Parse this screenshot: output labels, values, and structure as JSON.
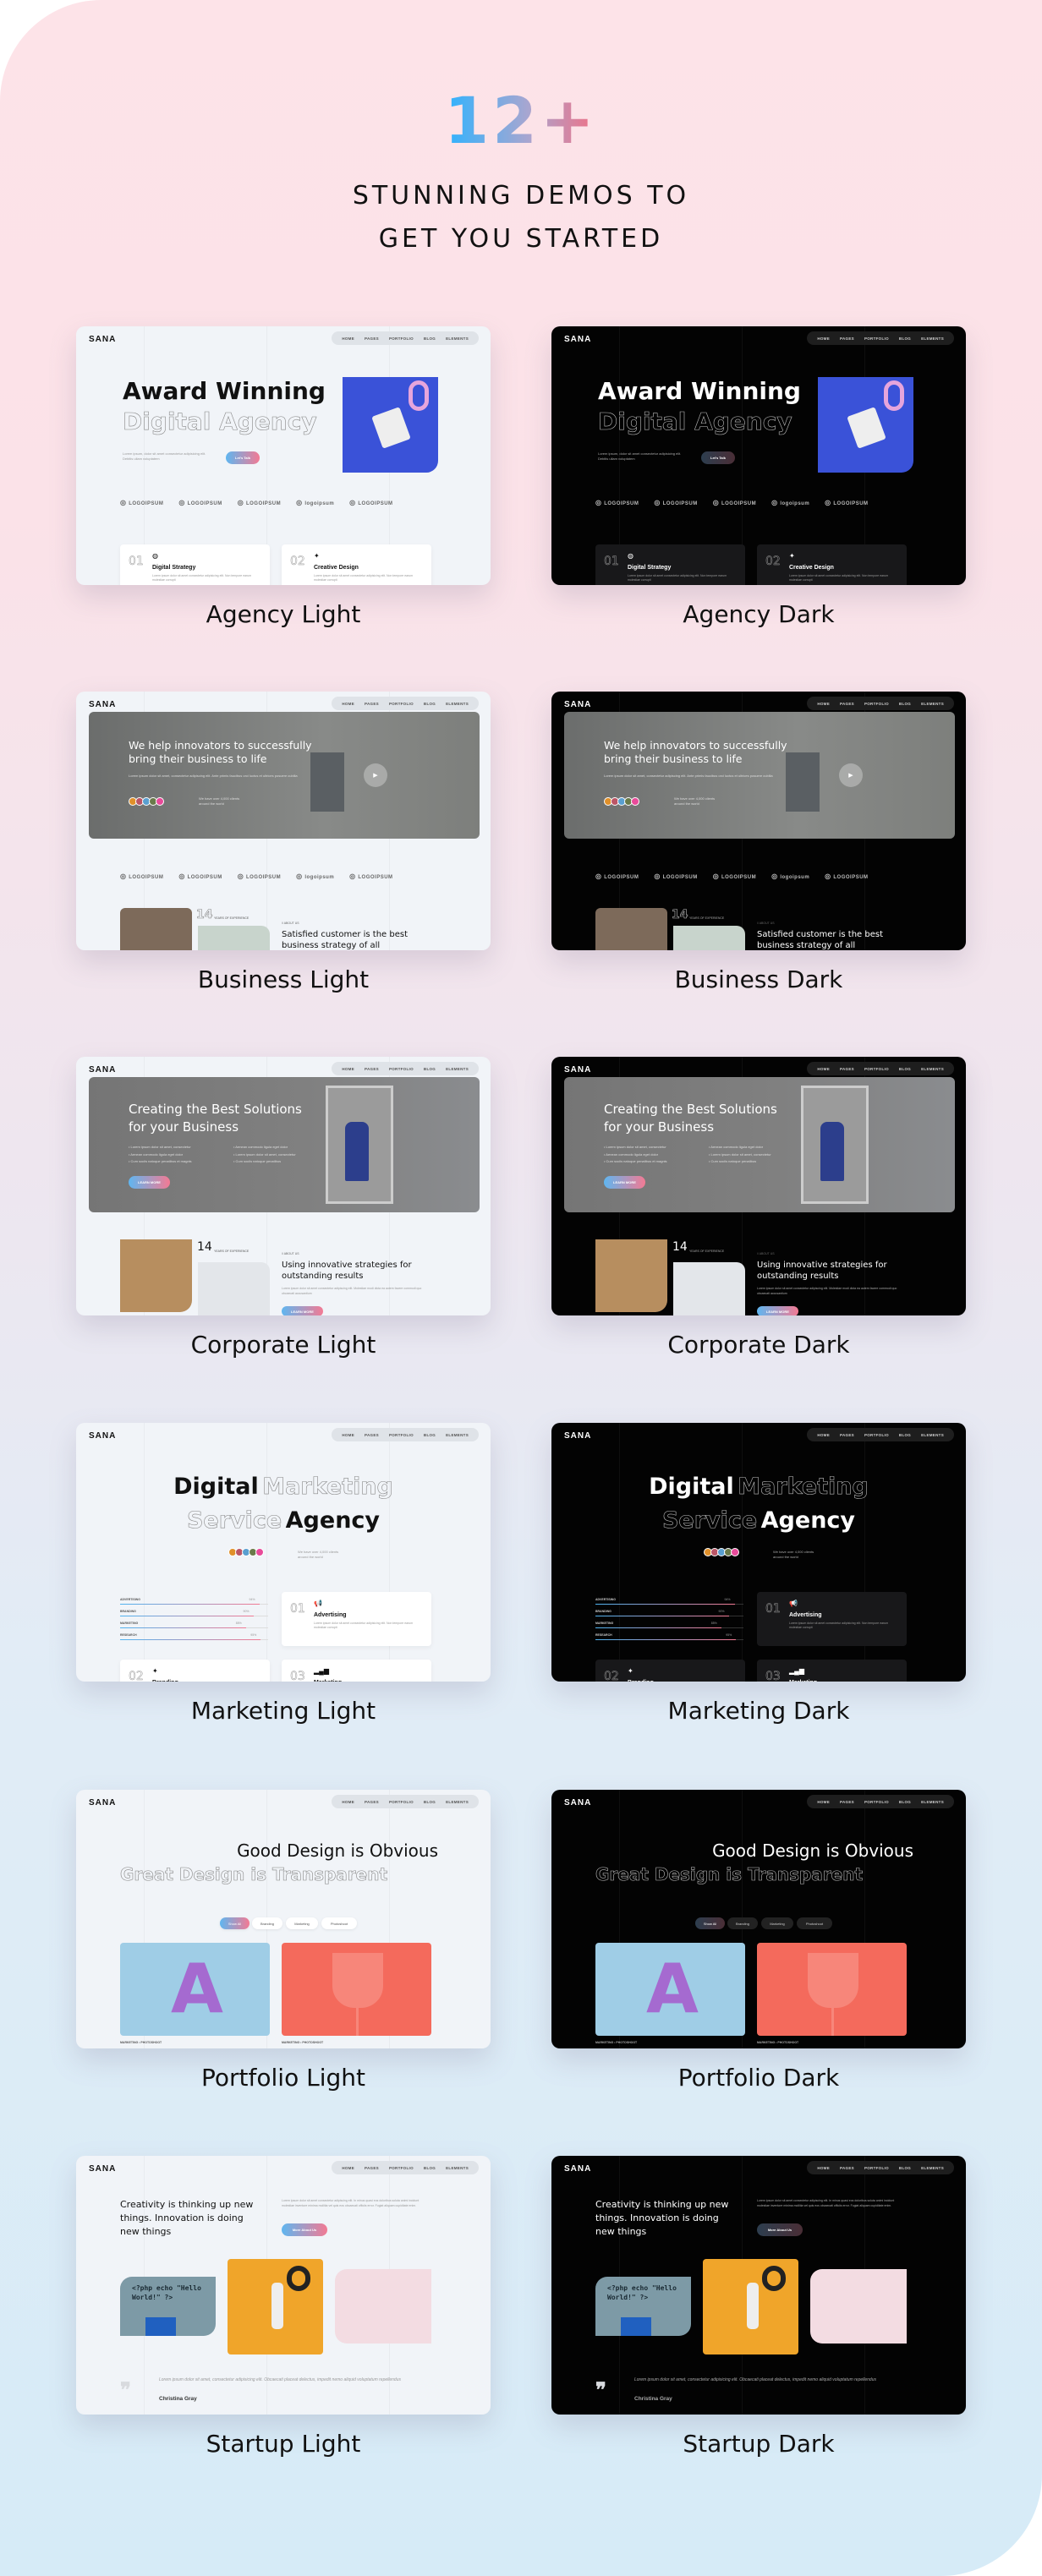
{
  "hero": {
    "count": "12+",
    "subtitle_line1": "STUNNING DEMOS TO",
    "subtitle_line2": "GET YOU STARTED",
    "gradient_colors": [
      "#2db3ff",
      "#a9a6d0",
      "#f16f84"
    ]
  },
  "nav": {
    "logo": "SANA",
    "items": [
      "HOME",
      "PAGES",
      "PORTFOLIO",
      "BLOG",
      "ELEMENTS"
    ]
  },
  "logos": [
    "LOGOIPSUM",
    "LOGOIPSUM",
    "LOGOIPSUM",
    "logoipsum",
    "LOGOIPSUM"
  ],
  "demos": {
    "agency": {
      "light_label": "Agency Light",
      "dark_label": "Agency Dark",
      "title1": "Award Winning",
      "title2": "Digital Agency",
      "desc": "Lorem ipsum, dolor sit amet consectetur adipisicing elit. Debitis ullam voluptatem",
      "button": "Let's Talk",
      "services": [
        {
          "num": "01",
          "title": "Digital Strategy",
          "desc": "Lorem ipsum dolor sit amet consectetur adipisicing elit. Non tempore earum molestiae corrupti"
        },
        {
          "num": "02",
          "title": "Creative Design",
          "desc": "Lorem ipsum dolor sit amet consectetur adipisicing elit. Non tempore earum molestiae corrupti"
        }
      ]
    },
    "business": {
      "light_label": "Business Light",
      "dark_label": "Business Dark",
      "title": "We help innovators to successfully bring their business to life",
      "desc": "Lorem ipsum dolor sit amet, consectetur adipiscing elit. Ante primis faucibus orci luctus et ultrices posuere cubilia",
      "clients": "We have over 4,000 clients around the world",
      "years": "14",
      "years_label": "YEARS OF EXPERIENCE",
      "about_tag": "// ABOUT US",
      "about_title": "Satisfied customer is the best business strategy of all"
    },
    "corporate": {
      "light_label": "Corporate Light",
      "dark_label": "Corporate Dark",
      "title": "Creating the Best Solutions for your Business",
      "bullets": [
        "Lorem ipsum dolor sit amet, consectetur",
        "Aenean commodo ligula eget dolor",
        "Cum sociis natoque penatibus et magnis",
        "Aenean commodo ligula eget dolor",
        "Lorem ipsum dolor sit amet, consectetur",
        "Cum sociis natoque penatibus"
      ],
      "button": "LEARN MORE",
      "years": "14",
      "years_label": "YEARS OF EXPERIENCE",
      "about_tag": "// ABOUT US",
      "about_title": "Using innovative strategies for outstanding results",
      "about_desc": "Lorem ipsum dolor sit amet consectetur adipiscing elit. Molestiae modi dicta ea autem facere commodi quo obcaecati accusantium"
    },
    "marketing": {
      "light_label": "Marketing Light",
      "dark_label": "Marketing Dark",
      "title_solid1": "Digital",
      "title_outline1": "Marketing",
      "title_outline2": "Service",
      "title_solid2": "Agency",
      "clients": "We have over 4,000 clients around the world",
      "skills": [
        {
          "name": "ADVERTISING",
          "value": 94
        },
        {
          "name": "BRANDING",
          "value": 90
        },
        {
          "name": "MARKETING",
          "value": 85
        },
        {
          "name": "RESEARCH",
          "value": 95
        }
      ],
      "services": [
        {
          "num": "01",
          "title": "Advertising",
          "desc": "Lorem ipsum dolor sit amet consectetur adipisicing elit. Non tempore earum molestiae corrupti"
        },
        {
          "num": "02",
          "title": "Branding"
        },
        {
          "num": "03",
          "title": "Marketing"
        }
      ]
    },
    "portfolio": {
      "light_label": "Portfolio Light",
      "dark_label": "Portfolio Dark",
      "title1": "Good Design is Obvious",
      "title2": "Great Design is Transparent",
      "filters": [
        "Show All",
        "Branding",
        "Marketing",
        "Photoshoot"
      ],
      "item_tag": "MARKETING • PHOTOSHOOT"
    },
    "startup": {
      "light_label": "Startup Light",
      "dark_label": "Startup Dark",
      "title": "Creativity is thinking up new things. Innovation is doing new things",
      "desc": "Lorem ipsum dolor sit amet consectetur adipiscing elit. In minus quasi eos doloribus soluta animi incidunt molestiae inventore minima mollitia vel quis eos obcaecati officiis error. Fugiat aliquam cupiditate enim.",
      "button": "More About Us",
      "code": "<?php echo \"Hello World!\" ?>",
      "quote": "Lorem ipsum dolor sit amet, consectetur adipisicing elit. Obcaecati placeat delectus, impedit nemo aliquid voluptatum repellendus",
      "author": "Christina Gray"
    }
  }
}
